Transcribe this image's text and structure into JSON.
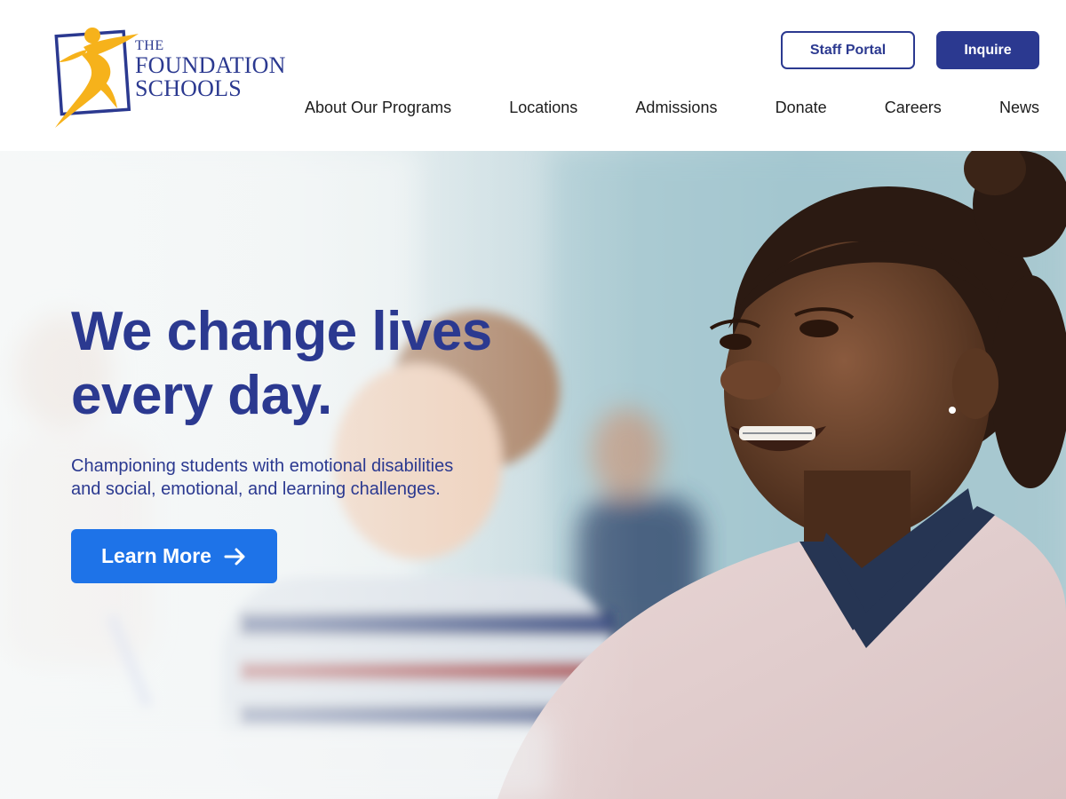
{
  "brand": {
    "line1": "THE",
    "line2": "FOUNDATION",
    "line3": "SCHOOLS",
    "colors": {
      "primary": "#2b3990",
      "accent": "#f6b21b",
      "cta": "#1e73e8"
    }
  },
  "header": {
    "staff_portal_label": "Staff Portal",
    "inquire_label": "Inquire"
  },
  "nav": {
    "items": [
      {
        "label": "About Our Programs"
      },
      {
        "label": "Locations"
      },
      {
        "label": "Admissions"
      },
      {
        "label": "Donate"
      },
      {
        "label": "Careers"
      },
      {
        "label": "News"
      }
    ]
  },
  "hero": {
    "title_line1": "We change lives",
    "title_line2": "every day.",
    "subtitle_line1": "Championing students with emotional disabilities",
    "subtitle_line2": "and social, emotional, and learning challenges.",
    "cta_label": "Learn More",
    "cta_icon": "arrow-right-icon",
    "photo_alt": "Smiling students in a classroom"
  }
}
